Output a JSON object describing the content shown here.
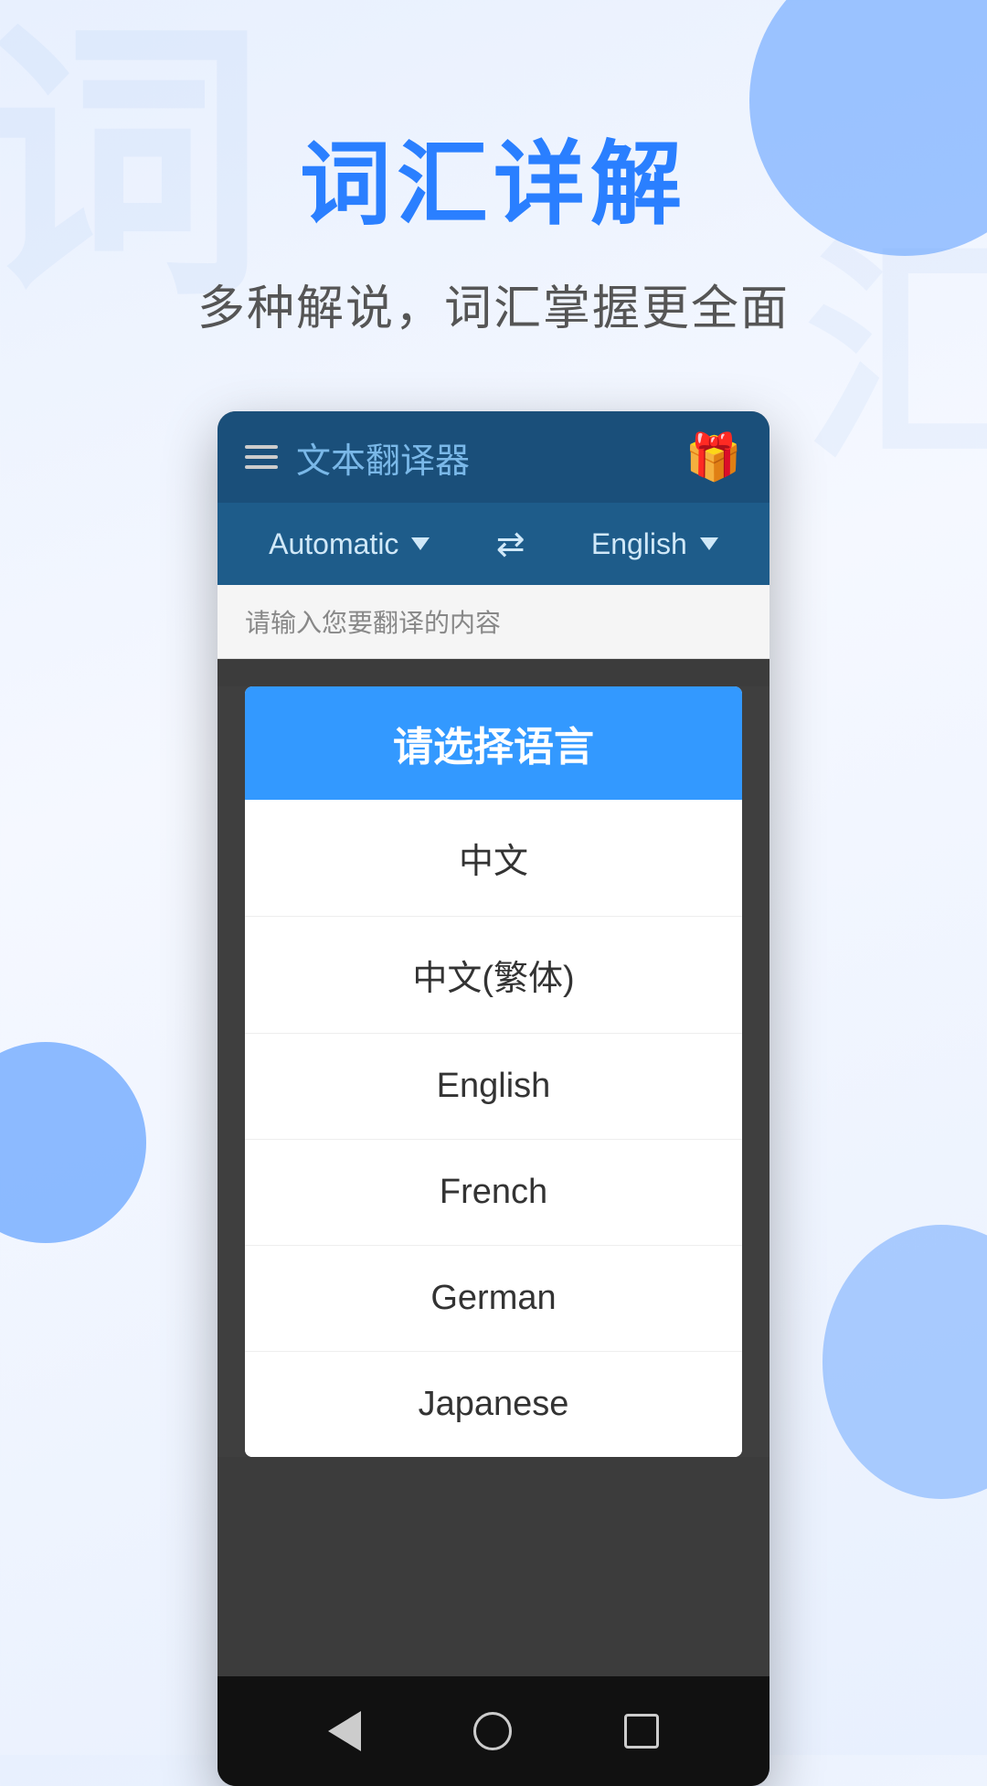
{
  "background": {
    "watermark1": "词",
    "watermark2": "汇"
  },
  "header": {
    "title": "词汇详解",
    "subtitle": "多种解说，词汇掌握更全面"
  },
  "app": {
    "toolbar": {
      "title": "文本翻译器",
      "gift_icon": "🎁"
    },
    "lang_selector": {
      "source_lang": "Automatic",
      "target_lang": "English"
    },
    "input_placeholder": "请输入您要翻译的内容"
  },
  "dialog": {
    "title": "请选择语言",
    "languages": [
      {
        "id": "zh",
        "label": "中文"
      },
      {
        "id": "zh-tw",
        "label": "中文(繁体)"
      },
      {
        "id": "en",
        "label": "English"
      },
      {
        "id": "fr",
        "label": "French"
      },
      {
        "id": "de",
        "label": "German"
      },
      {
        "id": "ja",
        "label": "Japanese"
      }
    ]
  },
  "bottom_nav": {
    "back_label": "back",
    "home_label": "home",
    "recents_label": "recents"
  }
}
